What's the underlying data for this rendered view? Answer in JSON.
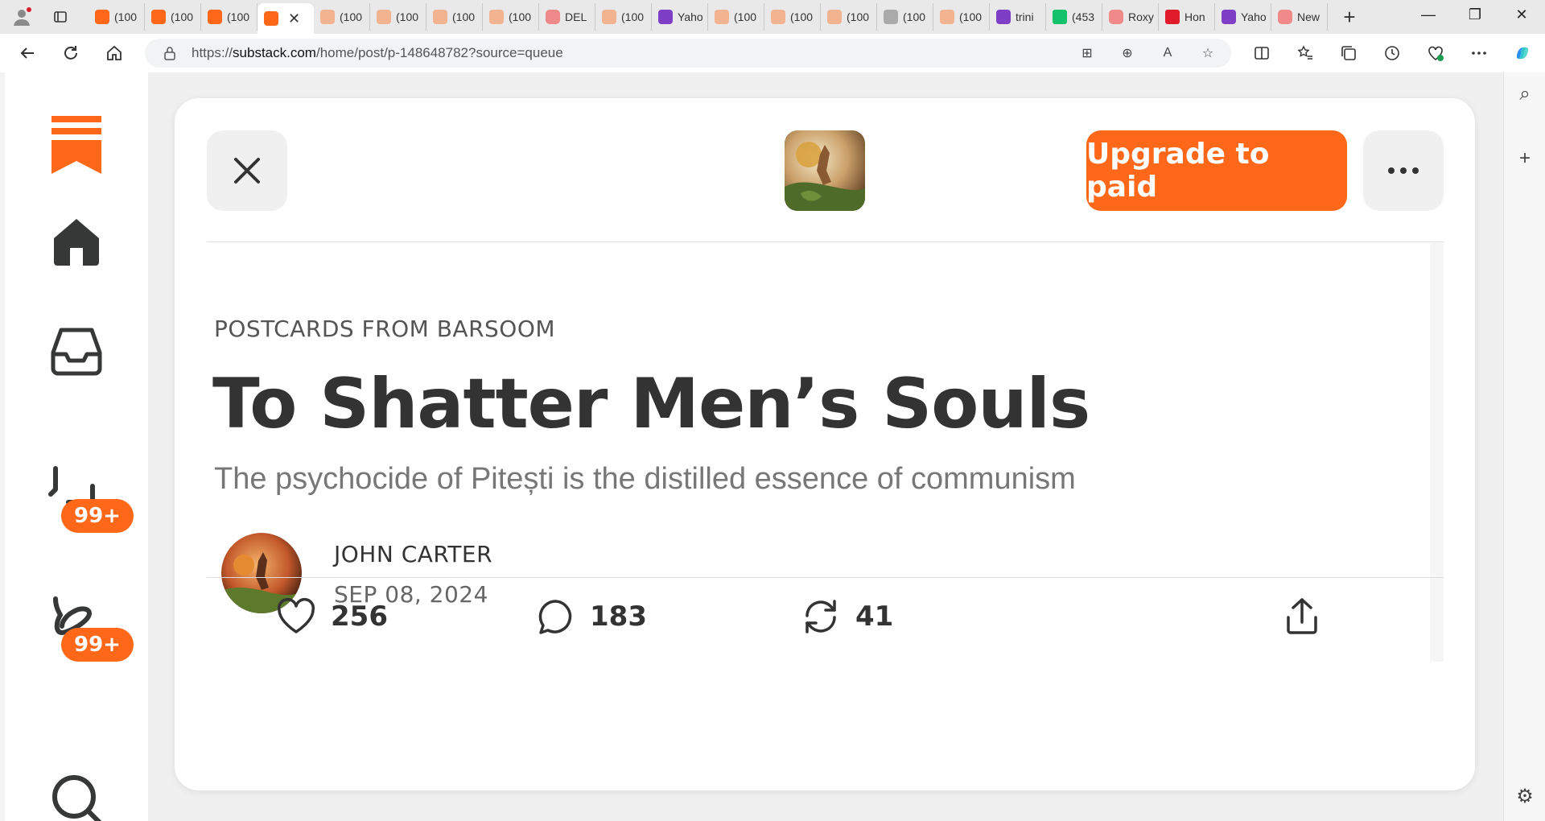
{
  "browser": {
    "tabs": [
      {
        "title": "(100",
        "favicon": "substack-icon",
        "style": "sub"
      },
      {
        "title": "(100",
        "favicon": "substack-icon",
        "style": "sub"
      },
      {
        "title": "(100",
        "favicon": "substack-icon",
        "style": "sub"
      },
      {
        "title": "",
        "favicon": "substack-icon",
        "style": "sub",
        "active": true
      },
      {
        "title": "(100",
        "favicon": "substack-icon",
        "style": "subdim"
      },
      {
        "title": "(100",
        "favicon": "substack-icon",
        "style": "subdim"
      },
      {
        "title": "(100",
        "favicon": "substack-icon",
        "style": "subdim"
      },
      {
        "title": "(100",
        "favicon": "substack-icon",
        "style": "subdim"
      },
      {
        "title": "DEL",
        "favicon": "youtube-icon",
        "style": "yt"
      },
      {
        "title": "(100",
        "favicon": "substack-icon",
        "style": "subdim"
      },
      {
        "title": "Yaho",
        "favicon": "yahoo-icon",
        "style": "yh"
      },
      {
        "title": "(100",
        "favicon": "substack-icon",
        "style": "subdim"
      },
      {
        "title": "(100",
        "favicon": "substack-icon",
        "style": "subdim"
      },
      {
        "title": "(100",
        "favicon": "substack-icon",
        "style": "subdim"
      },
      {
        "title": "(100",
        "favicon": "photo-icon",
        "style": "ph"
      },
      {
        "title": "(100",
        "favicon": "substack-icon",
        "style": "subdim"
      },
      {
        "title": "trini",
        "favicon": "yahoo-icon",
        "style": "yh"
      },
      {
        "title": "(453",
        "favicon": "grammarly-icon",
        "style": "gg"
      },
      {
        "title": "Roxy",
        "favicon": "youtube-icon",
        "style": "yt"
      },
      {
        "title": "Hon",
        "favicon": "iheart-icon",
        "style": "rd"
      },
      {
        "title": "Yaho",
        "favicon": "yahoo-icon",
        "style": "yh"
      },
      {
        "title": "New",
        "favicon": "youtube-icon",
        "style": "yt"
      }
    ],
    "url_prefix": "https://",
    "url_domain": "substack.com",
    "url_path": "/home/post/p-148648782?source=queue",
    "win_minimize": "—",
    "win_restore": "❐",
    "win_close": "✕"
  },
  "rail": {
    "chat_badge": "99+",
    "activity_badge": "99+"
  },
  "post": {
    "close_icon": "close-icon",
    "upgrade_label": "Upgrade to paid",
    "publication": "POSTCARDS FROM BARSOOM",
    "title": "To Shatter Men’s Souls",
    "subtitle": "The psychocide of Pitești is the distilled essence of communism",
    "author": "JOHN CARTER",
    "date": "SEP 08, 2024",
    "likes": "256",
    "comments": "183",
    "restacks": "41"
  },
  "colors": {
    "accent": "#ff6719",
    "text": "#333333",
    "muted": "#777777"
  }
}
